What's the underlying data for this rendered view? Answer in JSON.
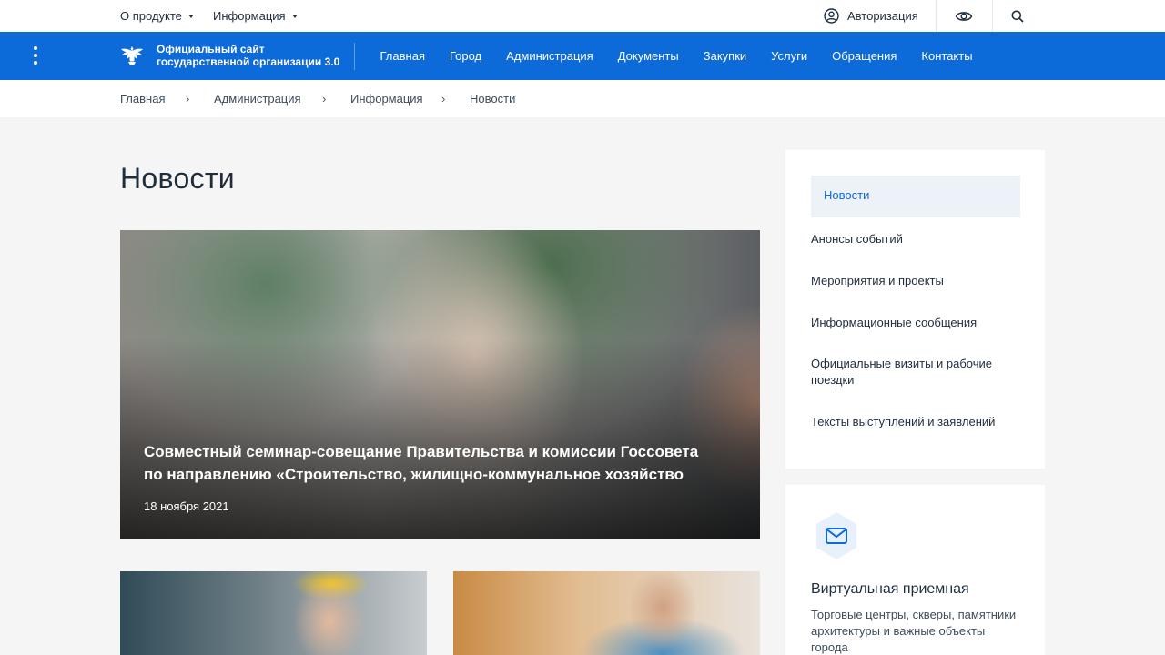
{
  "topbar": {
    "about_label": "О продукте",
    "info_label": "Информация",
    "login_label": "Авторизация"
  },
  "header": {
    "brand_line1": "Официальный сайт",
    "brand_line2": "государственной организации 3.0",
    "nav": [
      "Главная",
      "Город",
      "Администрация",
      "Документы",
      "Закупки",
      "Услуги",
      "Обращения",
      "Контакты"
    ]
  },
  "breadcrumb": [
    "Главная",
    "Администрация",
    "Информация",
    "Новости"
  ],
  "breadcrumb_separator": "›",
  "page_title": "Новости",
  "hero": {
    "title": "Совместный семинар-совещание Правительства и комиссии Госсовета по направлению «Строительство, жилищно-коммунальное хозяйство",
    "date": "18 ноября 2021"
  },
  "sidebar": {
    "active": "Новости",
    "items": [
      "Анонсы событий",
      "Мероприятия и проекты",
      "Информационные сообщения",
      "Официальные визиты и рабочие поездки",
      "Тексты выступлений и заявлений"
    ]
  },
  "reception": {
    "title": "Виртуальная приемная",
    "text": "Торговые центры, скверы, памятники архитектуры и важные объекты города"
  },
  "colors": {
    "primary": "#0d6ad9",
    "active_bg": "#edf2f9",
    "page_bg": "#f5f5f5",
    "text": "#1f2d3d"
  }
}
